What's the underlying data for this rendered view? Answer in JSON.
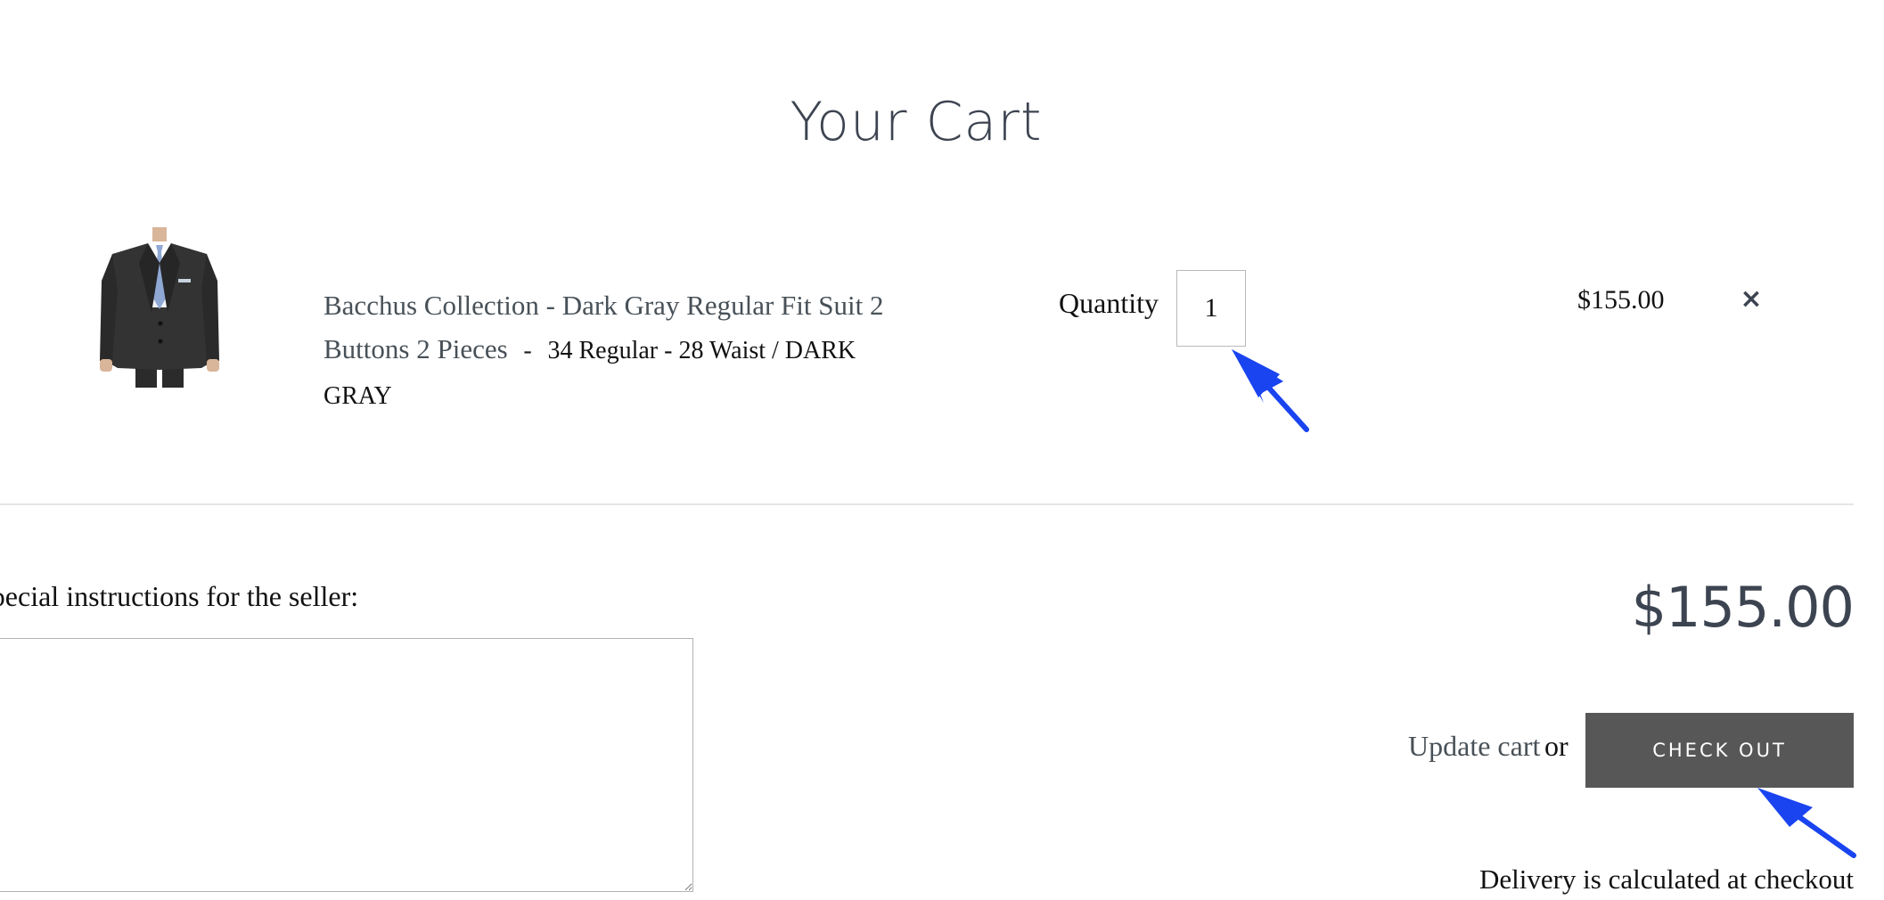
{
  "page": {
    "title": "Your Cart"
  },
  "cart": {
    "items": [
      {
        "title": "Bacchus Collection - Dark Gray Regular Fit Suit 2 Buttons 2 Pieces",
        "separator": "-",
        "variant": "34 Regular - 28 Waist / DARK GRAY",
        "quantity_label": "Quantity",
        "quantity": "1",
        "price": "$155.00",
        "remove_label": "×"
      }
    ],
    "note_label": "Special instructions for the seller:",
    "note_value": "",
    "subtotal": "$155.00",
    "update_label": "Update cart",
    "or_text": "or",
    "checkout_label": "CHECK OUT",
    "delivery_note": "Delivery is calculated at checkout"
  },
  "colors": {
    "heading": "#3d4451",
    "link": "#485158",
    "checkout_bg": "#575757",
    "annotation": "#1a44f0"
  },
  "icons": {
    "remove": "close-icon",
    "annotation": "arrow-pointer"
  }
}
